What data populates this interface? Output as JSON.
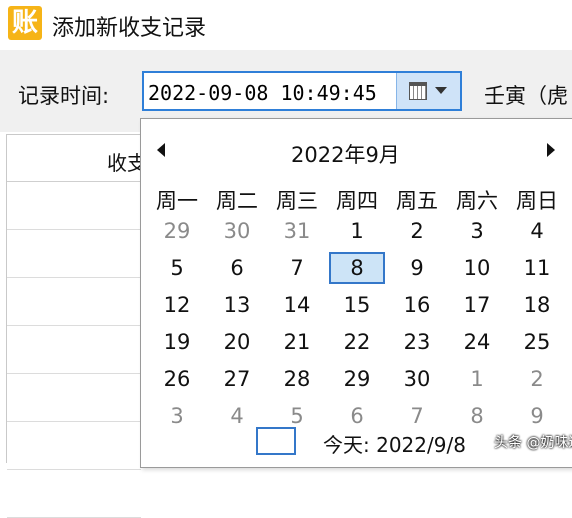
{
  "window": {
    "icon_char": "账",
    "title": "添加新收支记录"
  },
  "toolbar": {
    "time_label": "记录时间:",
    "datetime_value": "2022-09-08  10:49:45",
    "ganzhi": "壬寅（虎"
  },
  "list": {
    "column_header": "收支"
  },
  "calendar": {
    "month_title": "2022年9月",
    "weekdays": [
      "周一",
      "周二",
      "周三",
      "周四",
      "周五",
      "周六",
      "周日"
    ],
    "weeks": [
      [
        "29",
        "30",
        "31",
        "1",
        "2",
        "3",
        "4"
      ],
      [
        "5",
        "6",
        "7",
        "8",
        "9",
        "10",
        "11"
      ],
      [
        "12",
        "13",
        "14",
        "15",
        "16",
        "17",
        "18"
      ],
      [
        "19",
        "20",
        "21",
        "22",
        "23",
        "24",
        "25"
      ],
      [
        "26",
        "27",
        "28",
        "29",
        "30",
        "1",
        "2"
      ],
      [
        "3",
        "4",
        "5",
        "6",
        "7",
        "8",
        "9"
      ]
    ],
    "muted": [
      [
        true,
        true,
        true,
        false,
        false,
        false,
        false
      ],
      [
        false,
        false,
        false,
        false,
        false,
        false,
        false
      ],
      [
        false,
        false,
        false,
        false,
        false,
        false,
        false
      ],
      [
        false,
        false,
        false,
        false,
        false,
        false,
        false
      ],
      [
        false,
        false,
        false,
        false,
        false,
        true,
        true
      ],
      [
        true,
        true,
        true,
        true,
        true,
        true,
        true
      ]
    ],
    "selected_day": "8",
    "today_text": "今天: 2022/9/8"
  },
  "watermark": {
    "text": "头条 @奶味逗"
  },
  "colors": {
    "accent": "#3477c9",
    "selected_bg": "#cde4f7",
    "muted_text": "#8a8a8a",
    "app_icon": "#f6b417"
  },
  "icons": {
    "calendar_button": "calendar-icon",
    "dropdown": "chevron-down-icon",
    "prev_month": "triangle-left-icon",
    "next_month": "triangle-right-icon"
  }
}
